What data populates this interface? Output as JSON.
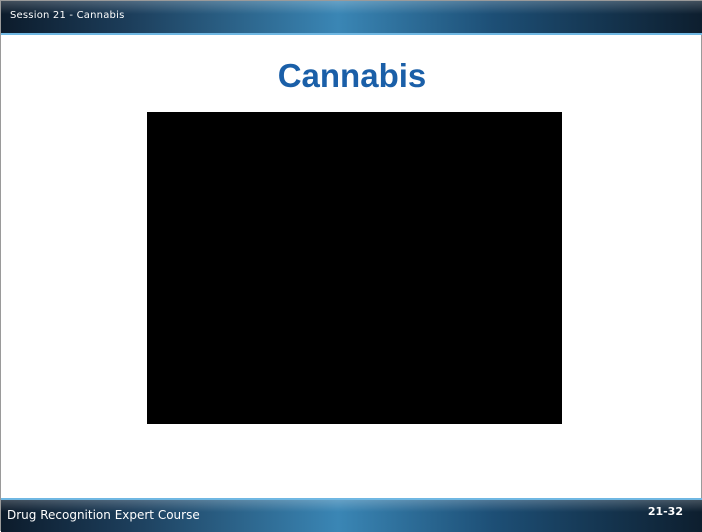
{
  "header": {
    "session_label": "Session 21 - Cannabis"
  },
  "slide": {
    "title": "Cannabis"
  },
  "footer": {
    "course_label": "Drug Recognition Expert Course",
    "page_number": "21-32"
  },
  "colors": {
    "title": "#1a5fa8",
    "bar_accent": "#3a86b5",
    "video_background": "#000000"
  }
}
